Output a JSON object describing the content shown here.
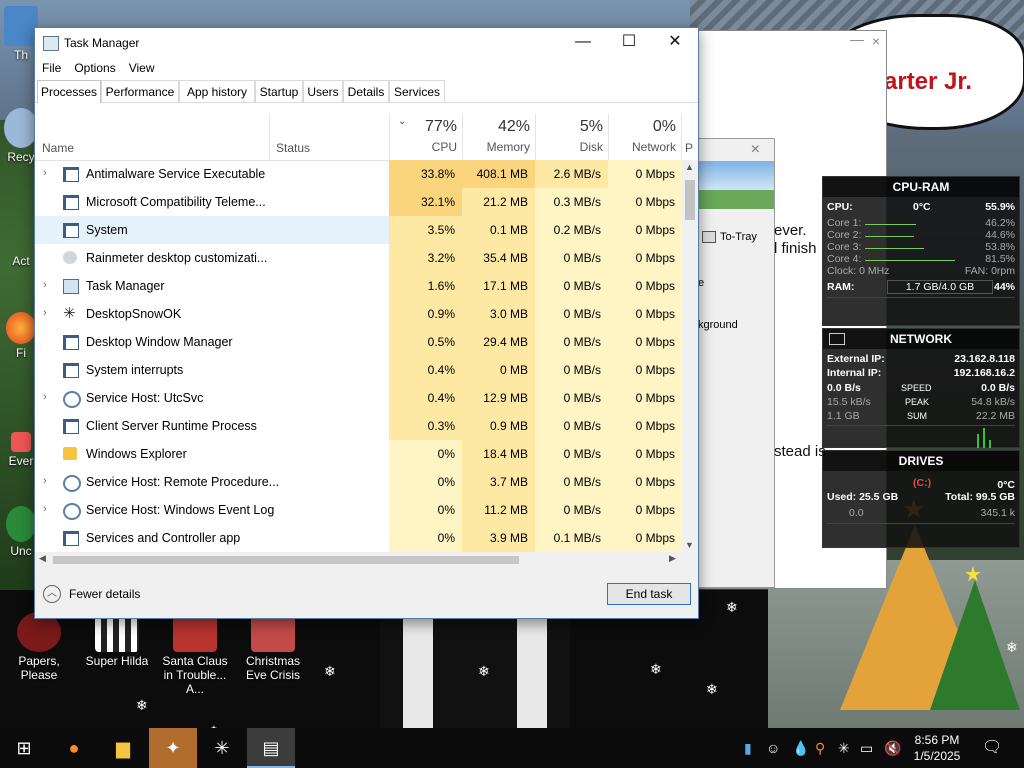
{
  "desktop": {
    "icons": [
      {
        "label": "Th"
      },
      {
        "label": "Recy"
      },
      {
        "label": "Act"
      },
      {
        "label": "Fi"
      },
      {
        "label": "Ever"
      },
      {
        "label": "Unc"
      },
      {
        "label": "Papers, Please"
      },
      {
        "label": "Super Hilda"
      },
      {
        "label": "Santa Claus in Trouble... A..."
      },
      {
        "label": "Christmas Eve Crisis"
      }
    ],
    "bg_text": {
      "speech": "arter Jr.",
      "line1": "ever.",
      "line2": "l finish",
      "line3": "stead is"
    }
  },
  "bg_window": {
    "to_tray": "To-Tray",
    "frag1": "e",
    "frag2": "kground"
  },
  "task_manager": {
    "title": "Task Manager",
    "menu": [
      "File",
      "Options",
      "View"
    ],
    "tabs": [
      "Processes",
      "Performance",
      "App history",
      "Startup",
      "Users",
      "Details",
      "Services"
    ],
    "active_tab": "Processes",
    "columns": {
      "name": "Name",
      "status": "Status",
      "cpu": {
        "pct": "77%",
        "label": "CPU"
      },
      "memory": {
        "pct": "42%",
        "label": "Memory"
      },
      "disk": {
        "pct": "5%",
        "label": "Disk"
      },
      "network": {
        "pct": "0%",
        "label": "Network"
      },
      "power": "P"
    },
    "processes": [
      {
        "name": "Antimalware Service Executable",
        "expand": true,
        "icon": "window-icon",
        "cpu": "33.8%",
        "mem": "408.1 MB",
        "disk": "2.6 MB/s",
        "net": "0 Mbps"
      },
      {
        "name": "Microsoft Compatibility Teleme...",
        "expand": false,
        "icon": "window-icon",
        "cpu": "32.1%",
        "mem": "21.2 MB",
        "disk": "0.3 MB/s",
        "net": "0 Mbps"
      },
      {
        "name": "System",
        "expand": false,
        "icon": "window-icon",
        "cpu": "3.5%",
        "mem": "0.1 MB",
        "disk": "0.2 MB/s",
        "net": "0 Mbps"
      },
      {
        "name": "Rainmeter desktop customizati...",
        "expand": false,
        "icon": "drop-icon",
        "cpu": "3.2%",
        "mem": "35.4 MB",
        "disk": "0 MB/s",
        "net": "0 Mbps"
      },
      {
        "name": "Task Manager",
        "expand": true,
        "icon": "task-manager-icon",
        "cpu": "1.6%",
        "mem": "17.1 MB",
        "disk": "0 MB/s",
        "net": "0 Mbps"
      },
      {
        "name": "DesktopSnowOK",
        "expand": true,
        "icon": "snowflake-icon",
        "cpu": "0.9%",
        "mem": "3.0 MB",
        "disk": "0 MB/s",
        "net": "0 Mbps"
      },
      {
        "name": "Desktop Window Manager",
        "expand": false,
        "icon": "window-icon",
        "cpu": "0.5%",
        "mem": "29.4 MB",
        "disk": "0 MB/s",
        "net": "0 Mbps"
      },
      {
        "name": "System interrupts",
        "expand": false,
        "icon": "window-icon",
        "cpu": "0.4%",
        "mem": "0 MB",
        "disk": "0 MB/s",
        "net": "0 Mbps"
      },
      {
        "name": "Service Host: UtcSvc",
        "expand": true,
        "icon": "gear-icon",
        "cpu": "0.4%",
        "mem": "12.9 MB",
        "disk": "0 MB/s",
        "net": "0 Mbps"
      },
      {
        "name": "Client Server Runtime Process",
        "expand": false,
        "icon": "window-icon",
        "cpu": "0.3%",
        "mem": "0.9 MB",
        "disk": "0 MB/s",
        "net": "0 Mbps"
      },
      {
        "name": "Windows Explorer",
        "expand": false,
        "icon": "folder-icon",
        "cpu": "0%",
        "mem": "18.4 MB",
        "disk": "0 MB/s",
        "net": "0 Mbps"
      },
      {
        "name": "Service Host: Remote Procedure...",
        "expand": true,
        "icon": "gear-icon",
        "cpu": "0%",
        "mem": "3.7 MB",
        "disk": "0 MB/s",
        "net": "0 Mbps"
      },
      {
        "name": "Service Host: Windows Event Log",
        "expand": true,
        "icon": "gear-icon",
        "cpu": "0%",
        "mem": "11.2 MB",
        "disk": "0 MB/s",
        "net": "0 Mbps"
      },
      {
        "name": "Services and Controller app",
        "expand": false,
        "icon": "window-icon",
        "cpu": "0%",
        "mem": "3.9 MB",
        "disk": "0.1 MB/s",
        "net": "0 Mbps"
      }
    ],
    "fewer_details": "Fewer details",
    "end_task": "End task"
  },
  "rainmeter": {
    "cpu_ram": {
      "title": "CPU-RAM",
      "cpu_label": "CPU:",
      "temp": "0°C",
      "cpu_total": "55.9%",
      "cores": [
        {
          "label": "Core 1:",
          "val": "46.2%",
          "level": 0.462
        },
        {
          "label": "Core 2:",
          "val": "44.6%",
          "level": 0.446
        },
        {
          "label": "Core 3:",
          "val": "53.8%",
          "level": 0.538
        },
        {
          "label": "Core 4:",
          "val": "81.5%",
          "level": 0.815
        }
      ],
      "clock": "Clock: 0 MHz",
      "fan": "FAN: 0rpm",
      "ram_label": "RAM:",
      "ram_val": "1.7 GB/4.0 GB",
      "ram_pct": "44%"
    },
    "network": {
      "title": "NETWORK",
      "ext_label": "External IP:",
      "ext_ip": "23.162.8.118",
      "int_label": "Internal IP:",
      "int_ip": "192.168.16.2",
      "down_speed": "0.0 B/s",
      "speed_label": "SPEED",
      "up_speed": "0.0 B/s",
      "peak_down": "15.5 kB/s",
      "peak_label": "PEAK",
      "peak_up": "54.8 kB/s",
      "sum_down": "1.1 GB",
      "sum_label": "SUM",
      "sum_up": "22.2 MB"
    },
    "drives": {
      "title": "DRIVES",
      "drive": "(C:)",
      "temp": "0°C",
      "used": "Used: 25.5 GB",
      "total": "Total: 99.5 GB",
      "read": "0.0",
      "write": "345.1 k"
    }
  },
  "taskbar": {
    "time": "8:56 PM",
    "date": "1/5/2025"
  },
  "colors": {
    "cpu_hot": "#fbd57e",
    "cpu_warm": "#fde9a4",
    "heat_light": "#fff4c4",
    "selection": "#e5f1fb",
    "accent": "#2f6fc7"
  }
}
